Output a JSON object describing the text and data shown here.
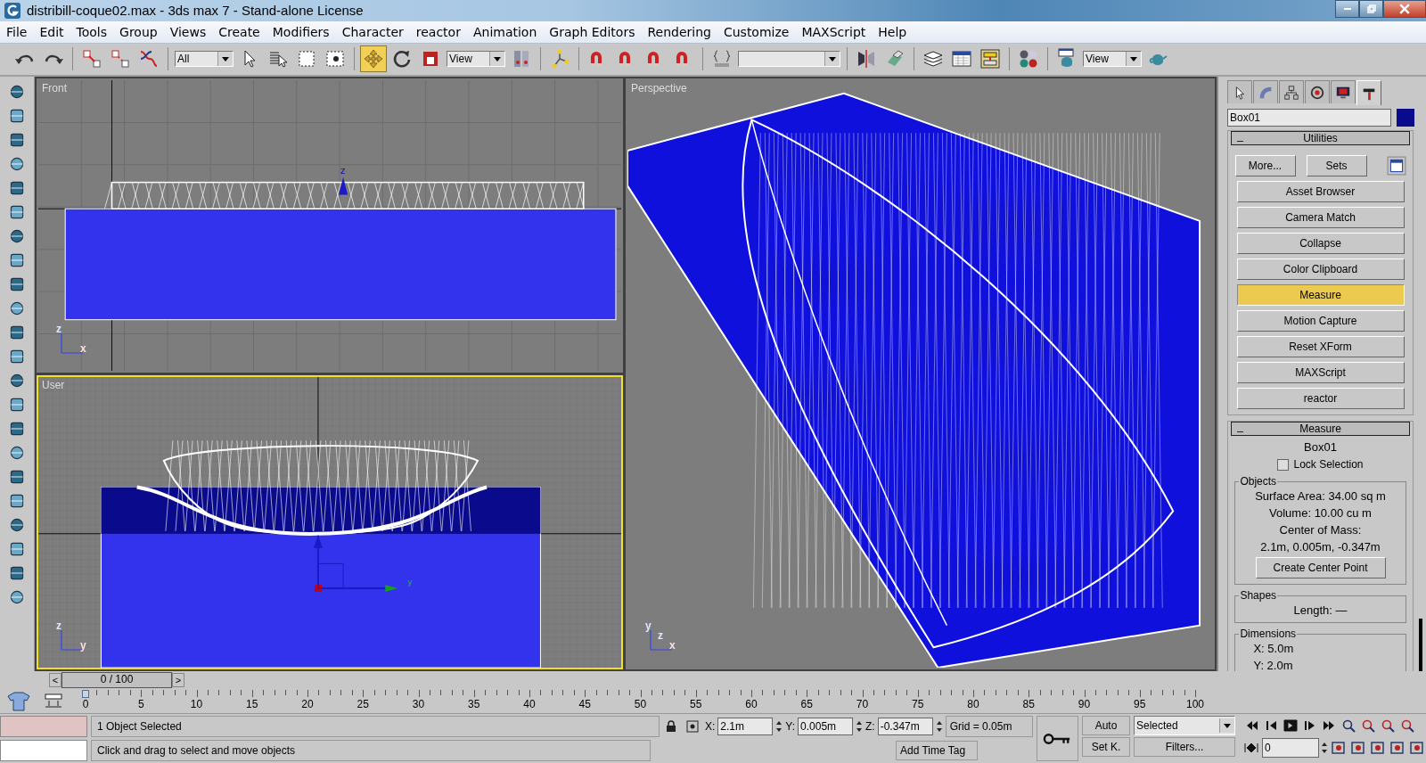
{
  "window": {
    "title": "distribill-coque02.max - 3ds max 7  - Stand-alone License"
  },
  "menu": [
    "File",
    "Edit",
    "Tools",
    "Group",
    "Views",
    "Create",
    "Modifiers",
    "Character",
    "reactor",
    "Animation",
    "Graph Editors",
    "Rendering",
    "Customize",
    "MAXScript",
    "Help"
  ],
  "toolbar": {
    "selection_filter": "All",
    "reference_coord": "View",
    "render_type": "View",
    "move_active": true
  },
  "viewports": [
    {
      "label": "Front",
      "kind": "front",
      "active": false,
      "gizmo_label": "z",
      "axes": [
        "x",
        "z"
      ]
    },
    {
      "label": "User",
      "kind": "user",
      "active": true,
      "gizmo_label": "y",
      "axes": [
        "y",
        "z"
      ]
    },
    {
      "label": "Perspective",
      "kind": "perspective",
      "active": false,
      "axes": [
        "x",
        "y",
        "z"
      ]
    }
  ],
  "command_panel": {
    "tabs": [
      {
        "selected": false
      },
      {
        "selected": false
      },
      {
        "selected": false
      },
      {
        "selected": false
      },
      {
        "selected": false
      },
      {
        "selected": true
      }
    ],
    "object_name": "Box01",
    "utilities": {
      "title": "Utilities",
      "toggle": "_",
      "more": "More...",
      "sets": "Sets",
      "items": [
        {
          "label": "Asset Browser",
          "selected": false
        },
        {
          "label": "Camera Match",
          "selected": false
        },
        {
          "label": "Collapse",
          "selected": false
        },
        {
          "label": "Color Clipboard",
          "selected": false
        },
        {
          "label": "Measure",
          "selected": true
        },
        {
          "label": "Motion Capture",
          "selected": false
        },
        {
          "label": "Reset XForm",
          "selected": false
        },
        {
          "label": "MAXScript",
          "selected": false
        },
        {
          "label": "reactor",
          "selected": false
        }
      ]
    },
    "measure": {
      "title": "Measure",
      "toggle": "_",
      "object": "Box01",
      "lock_selection": {
        "label": "Lock Selection",
        "checked": false
      },
      "objects": {
        "title": "Objects",
        "lines": [
          "Surface Area:  34.00 sq m",
          "Volume:  10.00 cu m",
          "Center of Mass:",
          "2.1m, 0.005m, -0.347m"
        ],
        "button": "Create Center Point"
      },
      "shapes": {
        "title": "Shapes",
        "lines": [
          "Length:  —"
        ]
      },
      "dimensions": {
        "title": "Dimensions",
        "lines": [
          "X:   5.0m",
          "Y:   2.0m"
        ]
      }
    }
  },
  "timeline": {
    "slider": "0 / 100",
    "level": 0,
    "prev": "<",
    "next": ">",
    "ticks": [
      "0",
      "5",
      "10",
      "15",
      "20",
      "25",
      "30",
      "35",
      "40",
      "45",
      "50",
      "55",
      "60",
      "65",
      "70",
      "75",
      "80",
      "85",
      "90",
      "95",
      "100"
    ]
  },
  "status_bar": {
    "selection": "1 Object Selected",
    "prompt": "Click and drag to select and move objects",
    "coords": [
      {
        "label": "X:",
        "value": "2.1m"
      },
      {
        "label": "Y:",
        "value": "0.005m"
      },
      {
        "label": "Z:",
        "value": "-0.347m"
      }
    ],
    "grid": "Grid = 0.05m",
    "time_tag": "Add Time Tag",
    "auto_key": "Auto",
    "set_key": "Set K.",
    "key_filter": "Selected",
    "filters": "Filters...",
    "frame": "0"
  }
}
